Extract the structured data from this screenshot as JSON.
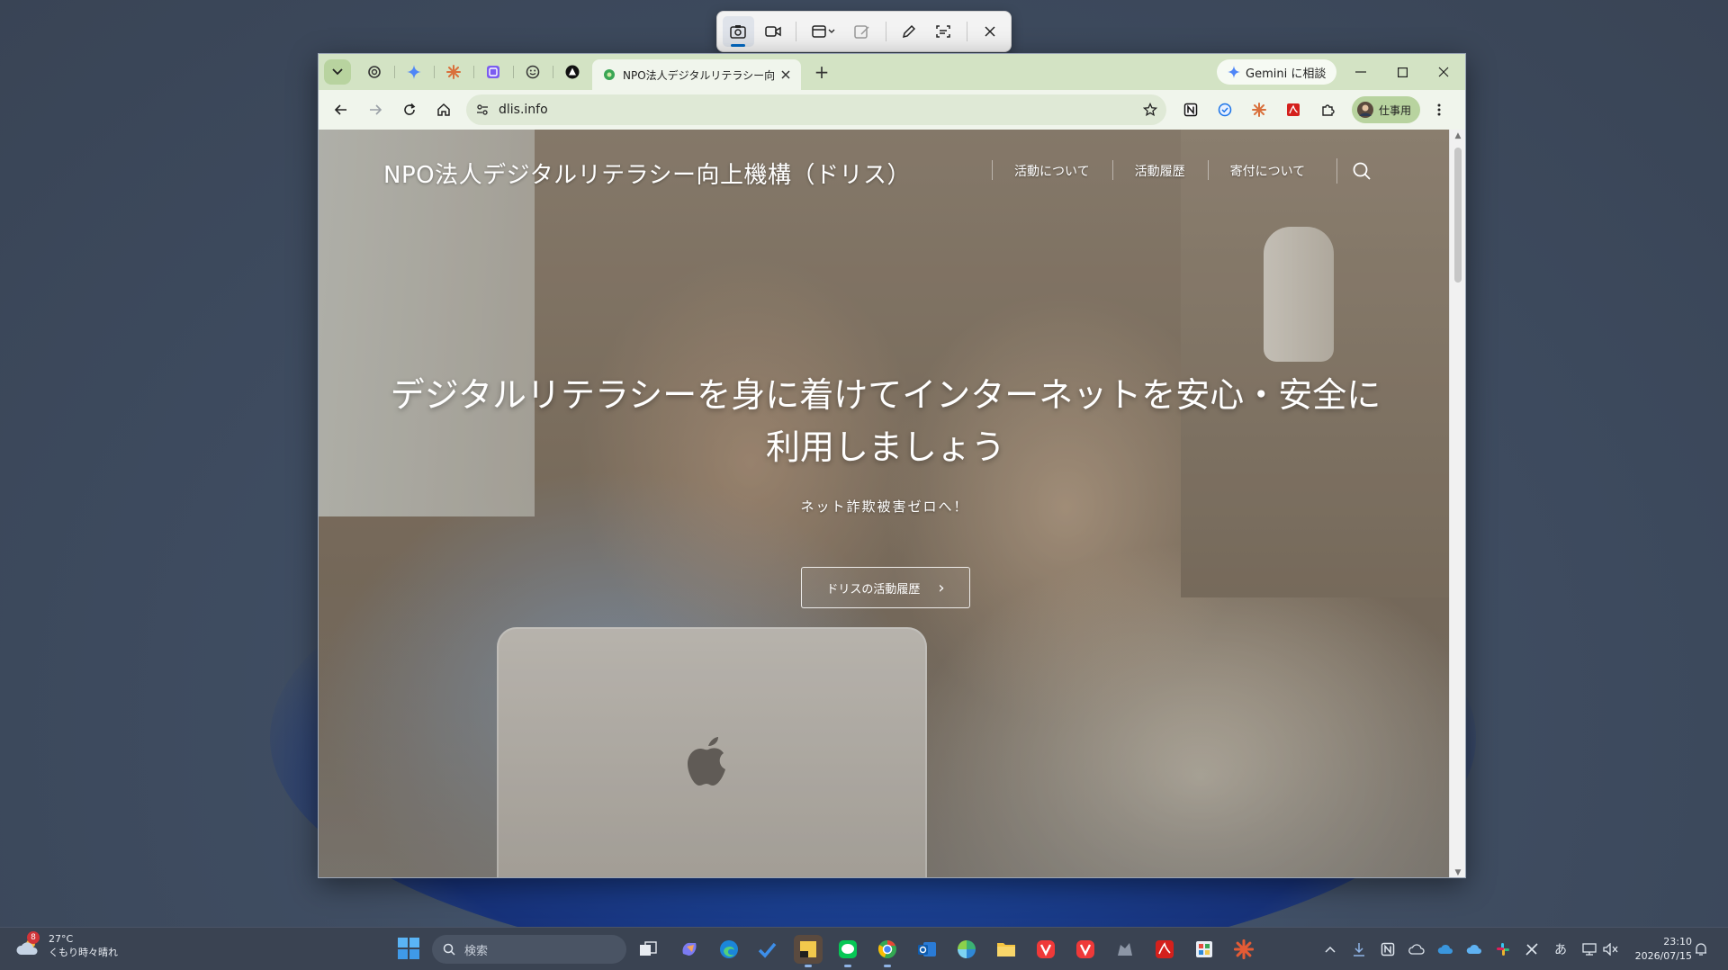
{
  "browser": {
    "active_tab_title": "NPO法人デジタルリテラシー向上機構",
    "gemini_label": "Gemini に相談",
    "url": "dlis.info",
    "profile_label": "仕事用",
    "new_tab_symbol": "+"
  },
  "site": {
    "title": "NPO法人デジタルリテラシー向上機構（ドリス）",
    "nav": [
      "活動について",
      "活動履歴",
      "寄付について"
    ],
    "hero_heading": "デジタルリテラシーを身に着けてインターネットを安心・安全に利用しましょう",
    "hero_sub": "ネット詐欺被害ゼロへ！",
    "cta_label": "ドリスの活動履歴",
    "cta_arrow": "›"
  },
  "taskbar": {
    "weather_temp": "27°C",
    "weather_desc": "くもり時々晴れ",
    "weather_badge": "8",
    "search_placeholder": "検索",
    "ime_label": "あ",
    "time": "23:10",
    "date": "2026/07/15"
  },
  "colors": {
    "tabstrip": "#d3e3c4",
    "toolbar": "#f0f5ec",
    "accent": "#0067c0",
    "taskbar": "#3a4352"
  }
}
